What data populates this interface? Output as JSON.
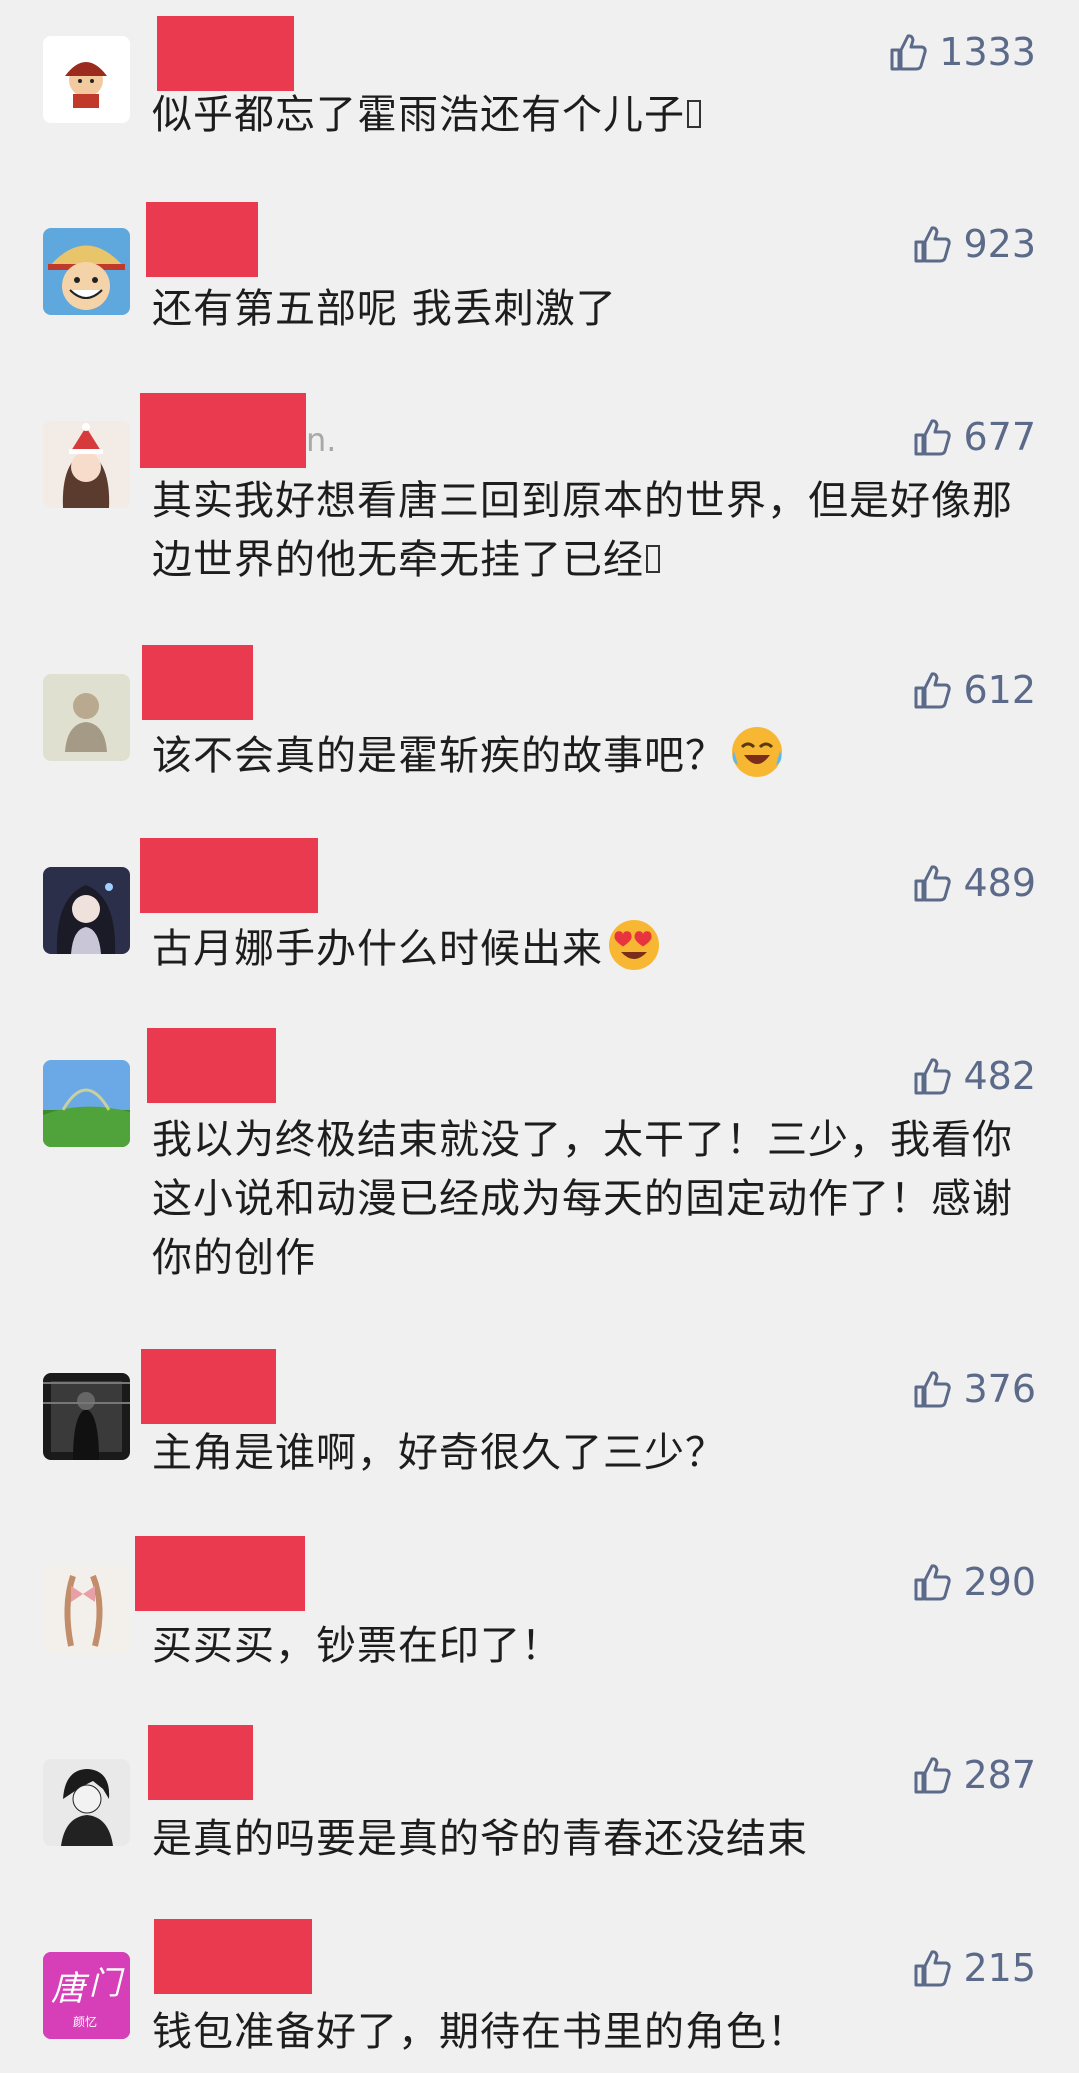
{
  "comments": [
    {
      "name_tail": "",
      "likes": "1333",
      "text": "似乎都忘了霍雨浩还有个儿子",
      "trailing": "missing-glyph"
    },
    {
      "name_tail": "",
      "likes": "923",
      "text": "还有第五部呢  我丢刺激了",
      "trailing": ""
    },
    {
      "name_tail": "n.",
      "likes": "677",
      "text": "其实我好想看唐三回到原本的世界，但是好像那边世界的他无牵无挂了已经",
      "trailing": "missing-glyph"
    },
    {
      "name_tail": "",
      "likes": "612",
      "text": "该不会真的是霍斩疾的故事吧？",
      "trailing": "laughing-crying-emoji"
    },
    {
      "name_tail": "",
      "likes": "489",
      "text": "古月娜手办什么时候出来",
      "trailing": "heart-eyes-emoji"
    },
    {
      "name_tail": "",
      "likes": "482",
      "text": "我以为终极结束就没了，太干了！三少，我看你这小说和动漫已经成为每天的固定动作了！感谢你的创作",
      "trailing": ""
    },
    {
      "name_tail": "",
      "likes": "376",
      "text": "主角是谁啊，好奇很久了三少？",
      "trailing": ""
    },
    {
      "name_tail": "",
      "likes": "290",
      "text": "买买买，钞票在印了！",
      "trailing": ""
    },
    {
      "name_tail": "",
      "likes": "287",
      "text": "是真的吗要是真的爷的青春还没结束",
      "trailing": ""
    },
    {
      "name_tail": "",
      "likes": "215",
      "text": "钱包准备好了，期待在书里的角色！",
      "trailing": ""
    }
  ],
  "avatar_text": {
    "brand_avatar_line1": "唐",
    "brand_avatar_line2": "门",
    "brand_avatar_small": "颜忆"
  },
  "colors": {
    "background": "#f0f0f0",
    "redaction": "#ea3a4f",
    "like_color": "#5c6a8a",
    "text": "#1d1d1d"
  },
  "icons": [
    "thumbs-up-icon"
  ]
}
